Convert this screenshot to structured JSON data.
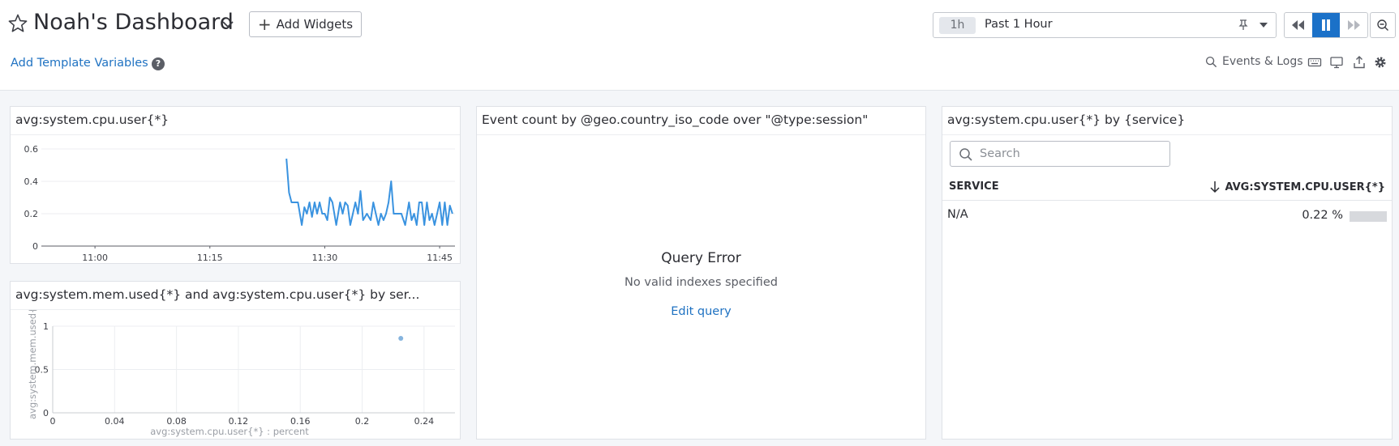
{
  "header": {
    "title": "Noah's Dashboard",
    "add_widgets_label": "Add Widgets",
    "template_variables_label": "Add Template Variables",
    "help_glyph": "?",
    "events_logs_label": "Events & Logs"
  },
  "time_controls": {
    "range_chip": "1h",
    "range_label": "Past 1 Hour",
    "state": "paused"
  },
  "icons": {
    "favorite": "star-icon",
    "title_menu": "chevron-down-icon",
    "pin": "pin-icon",
    "rewind": "rewind-icon",
    "pause": "pause-icon",
    "forward": "fast-forward-icon",
    "zoom_out": "zoom-out-icon",
    "events": "search-icon",
    "keyboard": "keyboard-icon",
    "tv_mode": "monitor-icon",
    "share": "share-icon",
    "settings": "gear-icon"
  },
  "colors": {
    "accent": "#1b71c8",
    "link": "#1f72c2",
    "series": "#3a93e0",
    "scatter_point": "#86b4de"
  },
  "widgets": {
    "timeseries": {
      "title": "avg:system.cpu.user{*}",
      "chart_data": {
        "type": "line",
        "y_ticks": [
          "0.6",
          "0.4",
          "0.2",
          "0"
        ],
        "x_ticks": [
          "11:00",
          "11:15",
          "11:30",
          "11:45"
        ],
        "ylim": [
          0,
          0.6
        ],
        "xlim": [
          "10:53",
          "11:47"
        ],
        "series": [
          {
            "x": [
              "11:25",
              "11:25:20",
              "11:25:40",
              "11:26",
              "11:26:30",
              "11:27",
              "11:27:20",
              "11:27:40",
              "11:28",
              "11:28:20",
              "11:28:40",
              "11:29",
              "11:29:20",
              "11:29:40",
              "11:30",
              "11:30:20",
              "11:30:40",
              "11:31",
              "11:31:30",
              "11:32",
              "11:32:20",
              "11:32:40",
              "11:33",
              "11:33:20",
              "11:33:40",
              "11:34",
              "11:34:20",
              "11:34:40",
              "11:35",
              "11:35:30",
              "11:36",
              "11:36:20",
              "11:36:40",
              "11:37",
              "11:37:20",
              "11:37:40",
              "11:38",
              "11:38:20",
              "11:38:40",
              "11:39",
              "11:39:20",
              "11:39:40",
              "11:40",
              "11:40:30",
              "11:41",
              "11:41:20",
              "11:41:40",
              "11:42",
              "11:42:20",
              "11:42:40",
              "11:43",
              "11:43:20",
              "11:43:40",
              "11:44",
              "11:44:20",
              "11:44:40",
              "11:45",
              "11:45:20",
              "11:45:40",
              "11:46",
              "11:46:20",
              "11:46:40"
            ],
            "y": [
              0.54,
              0.33,
              0.27,
              0.27,
              0.27,
              0.13,
              0.24,
              0.2,
              0.27,
              0.18,
              0.27,
              0.2,
              0.27,
              0.2,
              0.2,
              0.16,
              0.3,
              0.27,
              0.13,
              0.27,
              0.2,
              0.27,
              0.25,
              0.13,
              0.2,
              0.27,
              0.2,
              0.34,
              0.16,
              0.2,
              0.16,
              0.27,
              0.2,
              0.13,
              0.2,
              0.16,
              0.2,
              0.27,
              0.4,
              0.2,
              0.2,
              0.2,
              0.2,
              0.13,
              0.27,
              0.16,
              0.2,
              0.13,
              0.27,
              0.27,
              0.13,
              0.27,
              0.16,
              0.2,
              0.13,
              0.2,
              0.27,
              0.13,
              0.27,
              0.13,
              0.25,
              0.2
            ]
          }
        ]
      }
    },
    "scatter": {
      "title": "avg:system.mem.used{*} and avg:system.cpu.user{*} by ser...",
      "chart_data": {
        "type": "scatter",
        "xlabel": "avg:system.cpu.user{*} : percent",
        "ylabel": "avg:system.mem.used{",
        "x_ticks": [
          "0",
          "0.04",
          "0.08",
          "0.12",
          "0.16",
          "0.2",
          "0.24"
        ],
        "y_ticks": [
          "1",
          "0.5",
          "0"
        ],
        "xlim": [
          0,
          0.26
        ],
        "ylim": [
          0,
          1
        ],
        "points": [
          {
            "x": 0.225,
            "y": 0.86
          }
        ]
      }
    },
    "query_value": {
      "title": "Event count by @geo.country_iso_code over \"@type:session\"",
      "error_title": "Query Error",
      "error_message": "No valid indexes specified",
      "edit_link": "Edit query"
    },
    "toplist": {
      "title": "avg:system.cpu.user{*} by {service}",
      "search_placeholder": "Search",
      "col_service": "SERVICE",
      "col_value": "AVG:SYSTEM.CPU.USER{*}",
      "rows": [
        {
          "service": "N/A",
          "value": "0.22 %",
          "fraction": 0.22
        }
      ]
    }
  }
}
